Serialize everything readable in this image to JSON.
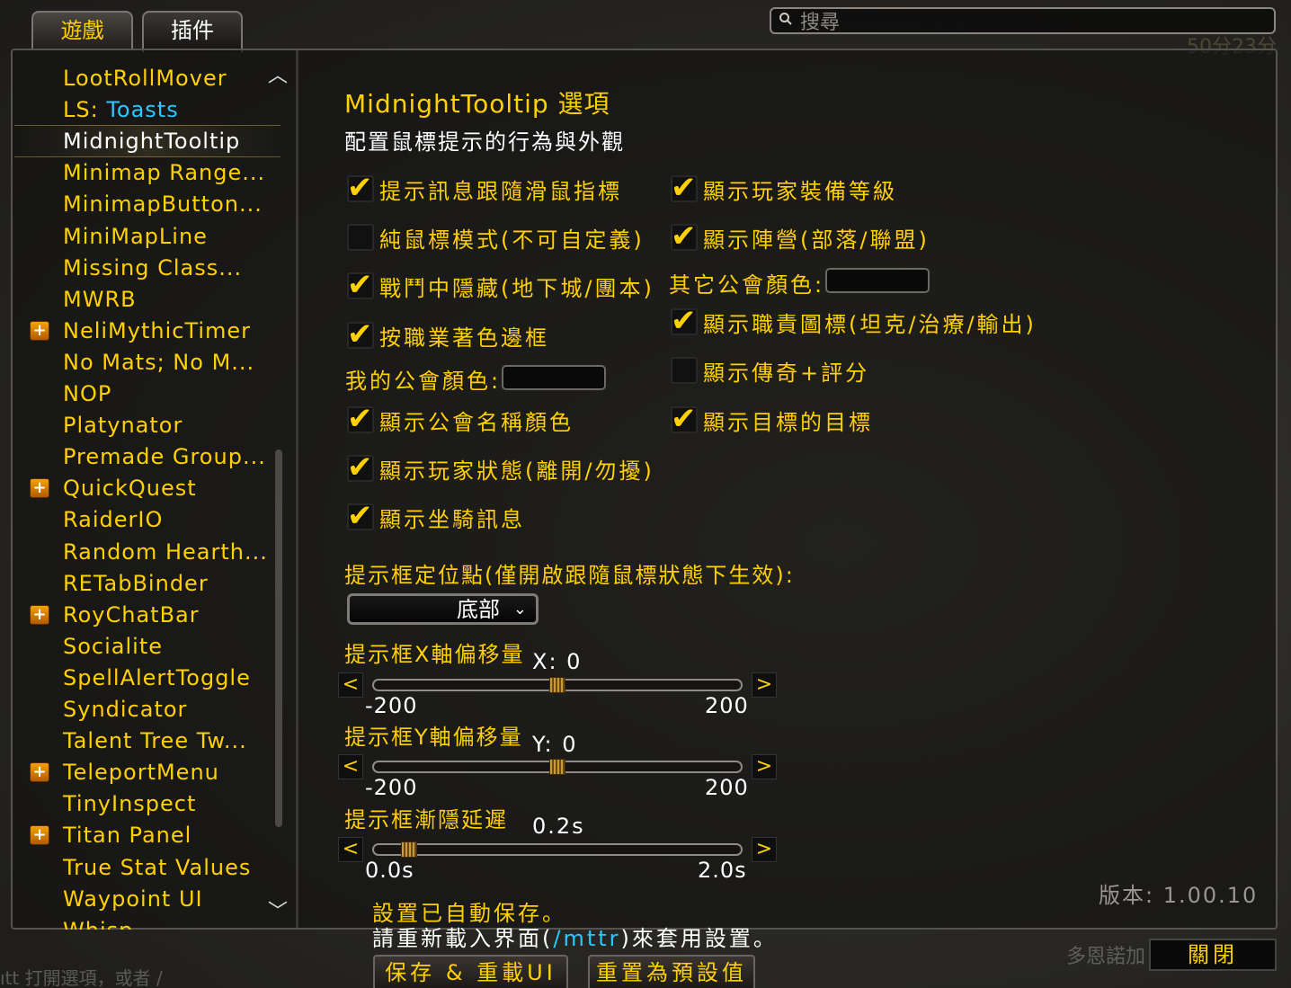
{
  "tabs": [
    {
      "label": "遊戲",
      "active": false
    },
    {
      "label": "插件",
      "active": true
    }
  ],
  "search": {
    "placeholder": "搜尋"
  },
  "addons": [
    {
      "label": "LootRollMover",
      "plus": false
    },
    {
      "label": "LS: ",
      "label_highlight": "Toasts",
      "plus": false
    },
    {
      "label": "MidnightTooltip",
      "plus": false,
      "selected": true
    },
    {
      "label": "Minimap Range...",
      "plus": false
    },
    {
      "label": "MinimapButton...",
      "plus": false
    },
    {
      "label": "MiniMapLine",
      "plus": false
    },
    {
      "label": "Missing Class...",
      "plus": false
    },
    {
      "label": "MWRB",
      "plus": false
    },
    {
      "label": "NeliMythicTimer",
      "plus": true
    },
    {
      "label": "No Mats; No M...",
      "plus": false
    },
    {
      "label": "NOP",
      "plus": false
    },
    {
      "label": "Platynator",
      "plus": false
    },
    {
      "label": "Premade Group...",
      "plus": false
    },
    {
      "label": "QuickQuest",
      "plus": true
    },
    {
      "label": "RaiderIO",
      "plus": false
    },
    {
      "label": "Random Hearth...",
      "plus": false
    },
    {
      "label": "RETabBinder",
      "plus": false
    },
    {
      "label": "RoyChatBar",
      "plus": true
    },
    {
      "label": "Socialite",
      "plus": false
    },
    {
      "label": "SpellAlertToggle",
      "plus": false
    },
    {
      "label": "Syndicator",
      "plus": false
    },
    {
      "label": "Talent Tree Tw...",
      "plus": false
    },
    {
      "label": "TeleportMenu",
      "plus": true
    },
    {
      "label": "TinyInspect",
      "plus": false
    },
    {
      "label": "Titan Panel",
      "plus": true
    },
    {
      "label": "True Stat Values",
      "plus": false
    },
    {
      "label": "Waypoint UI",
      "plus": false
    },
    {
      "label": "Whisp",
      "plus": false
    }
  ],
  "panel": {
    "title": "MidnightTooltip 選項",
    "subtitle": "配置鼠標提示的行為與外觀",
    "left_options": [
      {
        "label": "提示訊息跟隨滑鼠指標",
        "checked": true
      },
      {
        "label": "純鼠標模式(不可自定義)",
        "checked": false
      },
      {
        "label": "戰鬥中隱藏(地下城/團本)",
        "checked": true
      },
      {
        "label": "按職業著色邊框",
        "checked": true
      },
      {
        "label": "顯示公會名稱顏色",
        "checked": true
      },
      {
        "label": "顯示玩家狀態(離開/勿擾)",
        "checked": true
      },
      {
        "label": "顯示坐騎訊息",
        "checked": true
      }
    ],
    "right_options": [
      {
        "label": "顯示玩家裝備等級",
        "checked": true
      },
      {
        "label": "顯示陣營(部落/聯盟)",
        "checked": true
      },
      {
        "label": "顯示職責圖標(坦克/治療/輸出)",
        "checked": true
      },
      {
        "label": "顯示傳奇+評分",
        "checked": false
      },
      {
        "label": "顯示目標的目標",
        "checked": true
      }
    ],
    "my_guild_color_label": "我的公會顏色:",
    "other_guild_color_label": "其它公會顏色:",
    "anchor_label": "提示框定位點(僅開啟跟隨鼠標狀態下生效):",
    "anchor_value": "底部",
    "sliders": [
      {
        "label": "提示框X軸偏移量",
        "value_text": "X: 0",
        "min_text": "-200",
        "max_text": "200",
        "min": -200,
        "max": 200,
        "value": 0
      },
      {
        "label": "提示框Y軸偏移量",
        "value_text": "Y: 0",
        "min_text": "-200",
        "max_text": "200",
        "min": -200,
        "max": 200,
        "value": 0
      },
      {
        "label": "提示框漸隱延遲",
        "value_text": "0.2s",
        "min_text": "0.0s",
        "max_text": "2.0s",
        "min": 0,
        "max": 2,
        "value": 0.2
      }
    ],
    "arrow_left": "<",
    "arrow_right": ">",
    "autosave_text": "設置已自動保存。",
    "reload_prefix": "請重新載入界面(",
    "reload_cmd": "/mttr",
    "reload_suffix": ")來套用設置。",
    "version": "版本: 1.00.10",
    "save_reload_button": "保存 & 重載UI",
    "reset_button": "重置為預設值"
  },
  "close_button": "關閉",
  "background_text": {
    "timer": "50分23分",
    "bottom_left": "ıtt 打開選項，或者 /",
    "bottom_right": "多恩諾加"
  },
  "colors": {
    "gold": "#ffd100",
    "cyan": "#2bc8ff",
    "white": "#ffffff"
  }
}
